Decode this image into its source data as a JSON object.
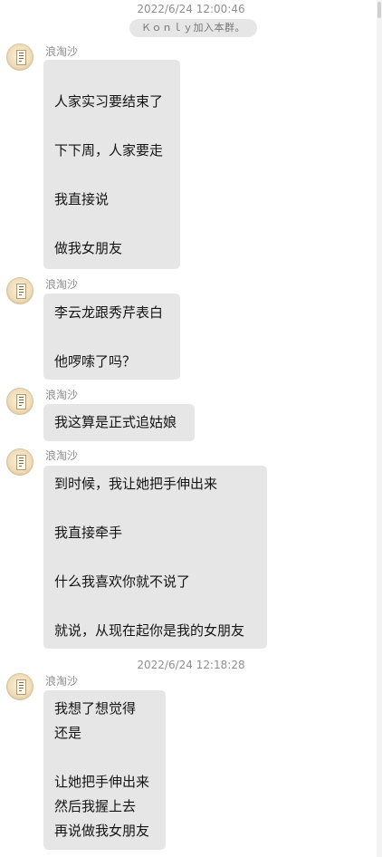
{
  "timestamps": [
    "2022/6/24 12:00:46",
    "2022/6/24 12:18:28"
  ],
  "system_notice": "Ｋｏｎｌｙ加入本群。",
  "messages": [
    {
      "sender": "浪淘沙",
      "text": "\n人家实习要结束了\n\n下下周，人家要走\n\n我直接说\n\n做我女朋友"
    },
    {
      "sender": "浪淘沙",
      "text": "李云龙跟秀芹表白\n\n他啰嗦了吗？"
    },
    {
      "sender": "浪淘沙",
      "text": "我这算是正式追姑娘"
    },
    {
      "sender": "浪淘沙",
      "text": "到时候，我让她把手伸出来\n\n我直接牵手\n\n什么我喜欢你就不说了\n\n就说，从现在起你是我的女朋友"
    },
    {
      "sender": "浪淘沙",
      "text": "我想了想觉得\n还是\n\n让她把手伸出来\n然后我握上去\n再说做我女朋友"
    }
  ]
}
